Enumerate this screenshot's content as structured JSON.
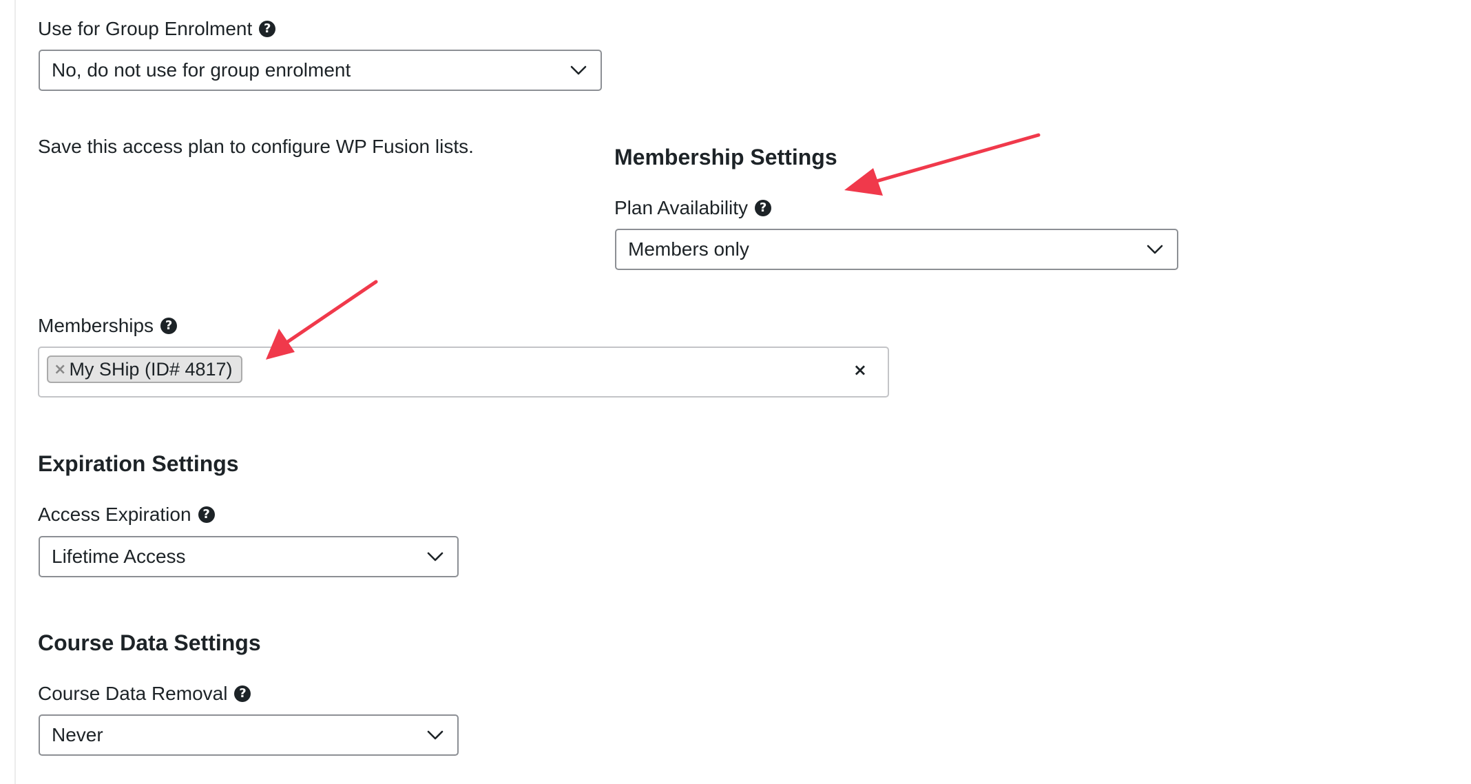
{
  "group_enrolment": {
    "label": "Use for Group Enrolment",
    "value": "No, do not use for group enrolment"
  },
  "wp_fusion_note": "Save this access plan to configure WP Fusion lists.",
  "membership_settings": {
    "heading": "Membership Settings",
    "plan_availability": {
      "label": "Plan Availability",
      "value": "Members only"
    }
  },
  "memberships": {
    "label": "Memberships",
    "tokens": [
      {
        "remove": "×",
        "label": "My SHip (ID# 4817)"
      }
    ],
    "clear": "×"
  },
  "expiration_settings": {
    "heading": "Expiration Settings",
    "access_expiration": {
      "label": "Access Expiration",
      "value": "Lifetime Access"
    }
  },
  "course_data_settings": {
    "heading": "Course Data Settings",
    "course_data_removal": {
      "label": "Course Data Removal",
      "value": "Never"
    }
  },
  "icons": {
    "help": "?",
    "chevron": "chevron-down-icon"
  },
  "colors": {
    "annotation_arrow": "#f0394b",
    "field_border": "#8c8f94",
    "token_bg": "#e4e4e4",
    "text": "#1d2327"
  }
}
